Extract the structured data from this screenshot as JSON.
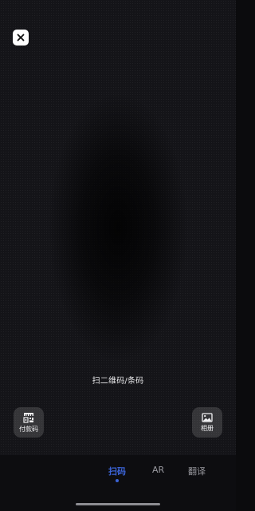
{
  "scanner": {
    "hint": "扫二维码/条码"
  },
  "actions": {
    "payment_code_label": "付款码",
    "album_label": "相册"
  },
  "tabs": [
    {
      "label": "扫码",
      "active": true
    },
    {
      "label": "AR",
      "active": false
    },
    {
      "label": "翻译",
      "active": false
    }
  ],
  "colors": {
    "accent": "#3b63d6",
    "background": "#141418"
  },
  "icons": {
    "close": "close-icon",
    "payment": "qr-code-icon",
    "album": "image-icon"
  }
}
